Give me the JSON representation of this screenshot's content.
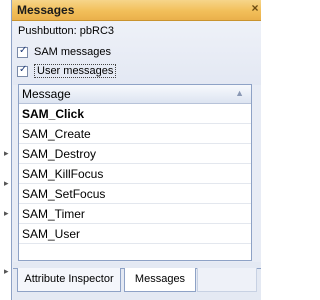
{
  "panel": {
    "title": "Messages",
    "close_glyph": "×"
  },
  "source_label": "Pushbutton: pbRC3",
  "options": [
    {
      "label": "SAM messages",
      "checked": true
    },
    {
      "label": "User messages",
      "checked": true
    }
  ],
  "list": {
    "column": "Message",
    "sort_glyph": "▲",
    "rows": [
      "SAM_Click",
      "SAM_Create",
      "SAM_Destroy",
      "SAM_KillFocus",
      "SAM_SetFocus",
      "SAM_Timer",
      "SAM_User"
    ],
    "selected_index": 0
  },
  "tabs": [
    {
      "label": "Attribute Inspector",
      "active": false
    },
    {
      "label": "Messages",
      "active": true
    }
  ],
  "colors": {
    "titlebar": "#f2bf5a",
    "panel_bg": "#e8ecf5",
    "border": "#8ea2c6"
  }
}
